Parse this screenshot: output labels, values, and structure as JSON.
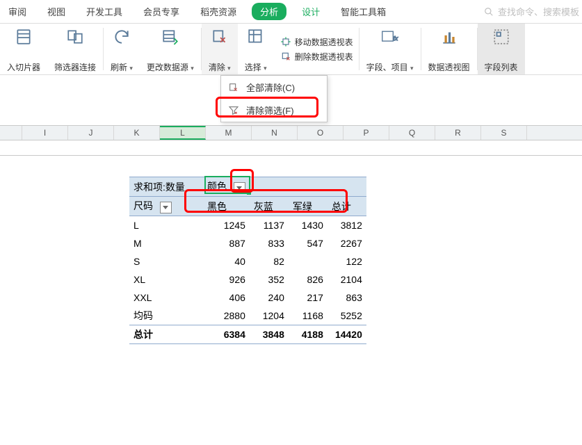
{
  "tabs": {
    "items": [
      "审阅",
      "视图",
      "开发工具",
      "会员专享",
      "稻壳资源",
      "分析",
      "设计",
      "智能工具箱"
    ],
    "active_index": 5
  },
  "search": {
    "placeholder": "查找命令、搜索模板"
  },
  "ribbon": {
    "slicer": "入切片器",
    "filter_link": "筛选器连接",
    "refresh": "刷新",
    "change_source": "更改数据源",
    "clear": "清除",
    "select": "选择",
    "move_pivot": "移动数据透视表",
    "delete_pivot": "删除数据透视表",
    "fields_items": "字段、项目",
    "pivot_chart": "数据透视图",
    "field_list": "字段列表"
  },
  "dropdown": {
    "clear_all": "全部清除(C)",
    "clear_filter": "清除筛选(F)"
  },
  "columns": [
    "I",
    "J",
    "K",
    "L",
    "M",
    "N",
    "O",
    "P",
    "Q",
    "R",
    "S"
  ],
  "active_column_index": 3,
  "pivot": {
    "corner": "求和项:数量",
    "col_field": "颜色",
    "row_field": "尺码",
    "col_headers": [
      "黑色",
      "灰蓝",
      "军绿",
      "总计"
    ],
    "rows": [
      {
        "label": "L",
        "v": [
          1245,
          1137,
          1430,
          3812
        ]
      },
      {
        "label": "M",
        "v": [
          887,
          833,
          547,
          2267
        ]
      },
      {
        "label": "S",
        "v": [
          40,
          82,
          null,
          122
        ]
      },
      {
        "label": "XL",
        "v": [
          926,
          352,
          826,
          2104
        ]
      },
      {
        "label": "XXL",
        "v": [
          406,
          240,
          217,
          863
        ]
      },
      {
        "label": "均码",
        "v": [
          2880,
          1204,
          1168,
          5252
        ]
      }
    ],
    "total_label": "总计",
    "totals": [
      6384,
      3848,
      4188,
      14420
    ]
  },
  "chart_data": {
    "type": "table",
    "title": "求和项:数量",
    "row_field": "尺码",
    "col_field": "颜色",
    "columns": [
      "黑色",
      "灰蓝",
      "军绿"
    ],
    "rows": [
      "L",
      "M",
      "S",
      "XL",
      "XXL",
      "均码"
    ],
    "values": [
      [
        1245,
        1137,
        1430
      ],
      [
        887,
        833,
        547
      ],
      [
        40,
        82,
        null
      ],
      [
        926,
        352,
        826
      ],
      [
        406,
        240,
        217
      ],
      [
        2880,
        1204,
        1168
      ]
    ],
    "row_totals": [
      3812,
      2267,
      122,
      2104,
      863,
      5252
    ],
    "col_totals": [
      6384,
      3848,
      4188
    ],
    "grand_total": 14420
  }
}
